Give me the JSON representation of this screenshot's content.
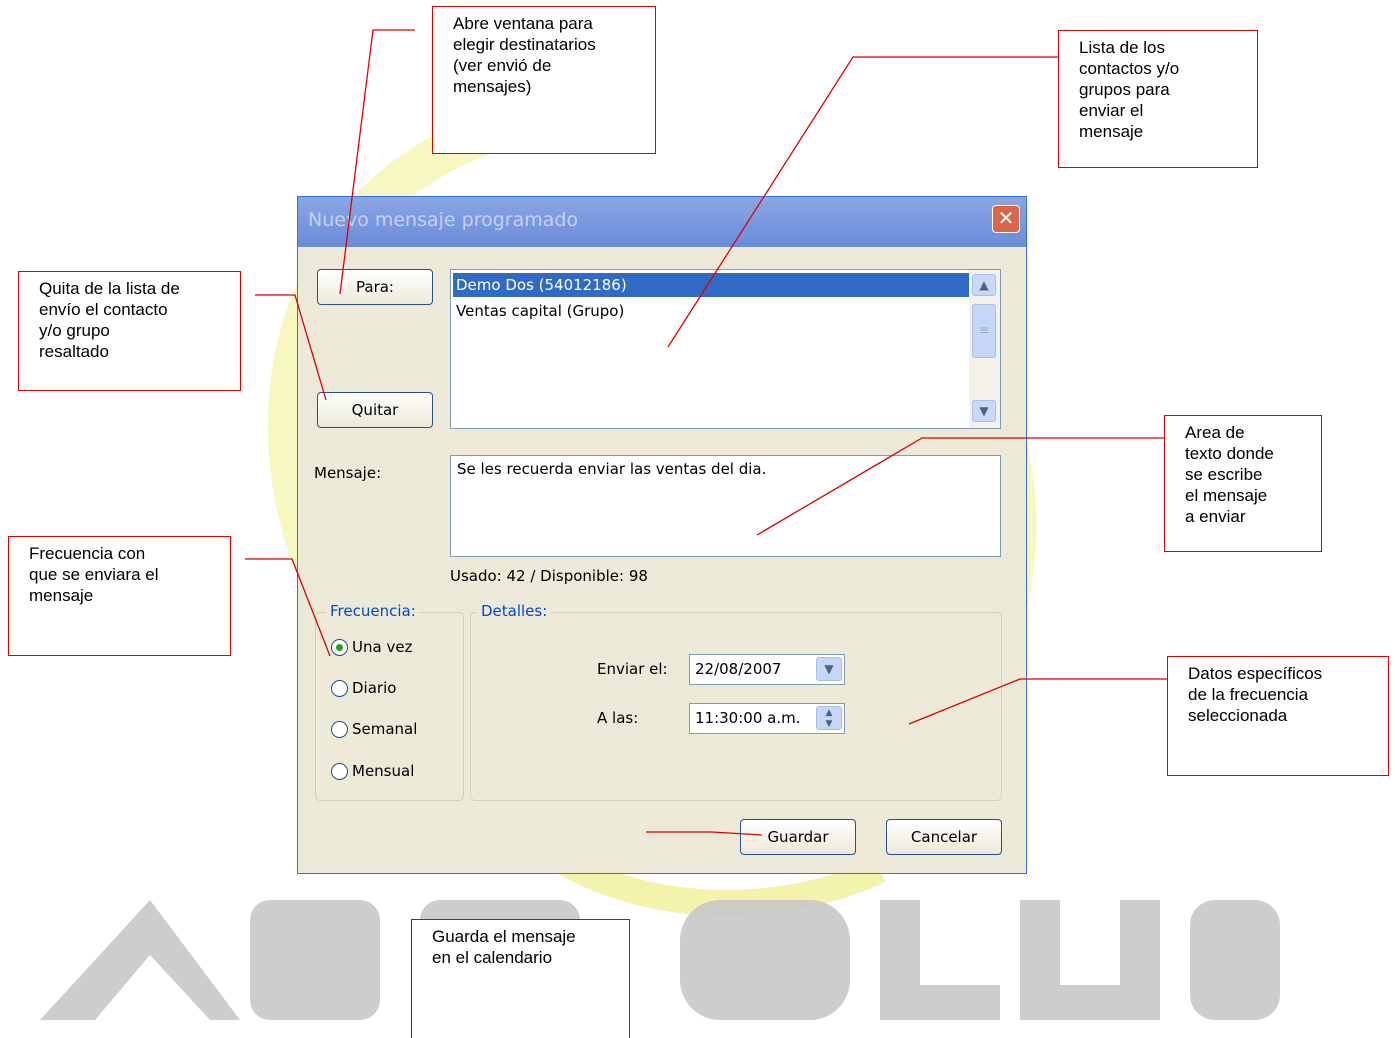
{
  "callouts": {
    "para": "Abre ventana  para\nelegir destinatarios\n(ver envió de\nmensajes)",
    "lista": "Lista de los\ncontactos y/o\ngrupos  para\nenviar el\nmensaje",
    "quitar": "Quita de la lista de\nenvío el contacto\ny/o grupo\nresaltado",
    "area": "Area de\ntexto donde\nse escribe\nel mensaje\na enviar",
    "frecuencia": "Frecuencia con\nque se enviara el\nmensaje",
    "datos": "Datos específicos\nde la frecuencia\nseleccionada",
    "guardar": "Guarda el mensaje\nen el calendario"
  },
  "dialog": {
    "title": "Nuevo mensaje programado",
    "close_glyph": "✕",
    "para_button": "Para:",
    "quitar_button": "Quitar",
    "recipients": [
      {
        "label": "Demo Dos (54012186)",
        "selected": true
      },
      {
        "label": "Ventas capital (Grupo)",
        "selected": false
      }
    ],
    "message_label": "Mensaje:",
    "message_text": "Se les recuerda enviar las ventas del dia.",
    "usage_text": "Usado: 42 / Disponible: 98",
    "frequency": {
      "legend": "Frecuencia:",
      "options": [
        {
          "label": "Una vez",
          "checked": true
        },
        {
          "label": "Diario",
          "checked": false
        },
        {
          "label": "Semanal",
          "checked": false
        },
        {
          "label": "Mensual",
          "checked": false
        }
      ]
    },
    "details": {
      "legend": "Detalles:",
      "send_on_label": "Enviar el:",
      "send_on_value": "22/08/2007",
      "at_label": "A las:",
      "at_value": "11:30:00 a.m."
    },
    "save_button": "Guardar",
    "cancel_button": "Cancelar"
  },
  "colors": {
    "callout_border": "#e00000",
    "selection": "#316ac5",
    "swirl": "#f6f6a6",
    "watermark": "#c8c8c8"
  },
  "icons": {
    "close": "close-icon",
    "scroll_up": "chevron-up-icon",
    "scroll_down": "chevron-down-icon",
    "dropdown": "chevron-down-icon",
    "spinner": "spinner-arrows-icon"
  }
}
